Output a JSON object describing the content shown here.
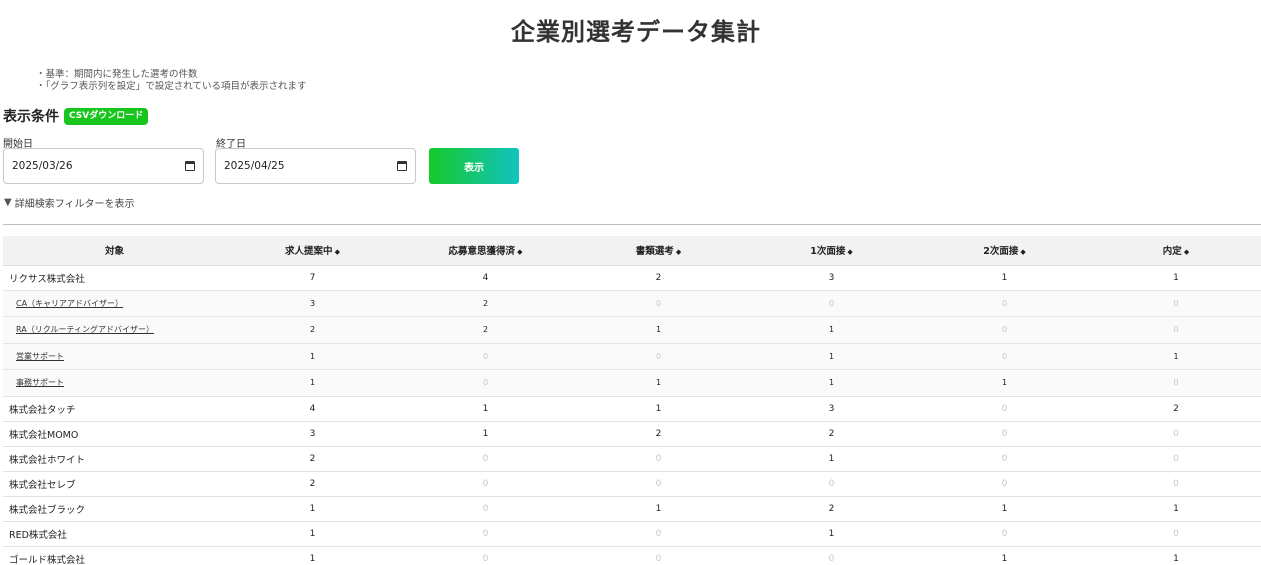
{
  "page": {
    "title": "企業別選考データ集計"
  },
  "notes": [
    "・基準：期間内に発生した選考の件数",
    "・「グラフ表示列を設定」で設定されている項目が表示されます"
  ],
  "conditions": {
    "title": "表示条件",
    "csv_label": "CSVダウンロード",
    "start_label": "開始日",
    "start_value": "2025/03/26",
    "end_label": "終了日",
    "end_value": "2025/04/25",
    "show_label": "表示",
    "filter_toggle": "詳細検索フィルターを表示"
  },
  "colors": {
    "csv_green": "#17c51c",
    "gradient_start": "#15c92a",
    "gradient_end": "#12c3bf"
  },
  "table": {
    "columns": [
      "対象",
      "求人提案中",
      "応募意思獲得済",
      "書類選考",
      "1次面接",
      "2次面接",
      "内定"
    ],
    "rows": [
      {
        "name": "リクサス株式会社",
        "sub": false,
        "values": [
          "7",
          "4",
          "2",
          "3",
          "1",
          "1"
        ]
      },
      {
        "name": "CA（キャリアアドバイザー）",
        "sub": true,
        "values": [
          "3",
          "2",
          "0",
          "0",
          "0",
          "0"
        ]
      },
      {
        "name": "RA（リクルーティングアドバイザー）",
        "sub": true,
        "values": [
          "2",
          "2",
          "1",
          "1",
          "0",
          "0"
        ]
      },
      {
        "name": "営業サポート",
        "sub": true,
        "values": [
          "1",
          "0",
          "0",
          "1",
          "0",
          "1"
        ]
      },
      {
        "name": "事務サポート",
        "sub": true,
        "values": [
          "1",
          "0",
          "1",
          "1",
          "1",
          "0"
        ]
      },
      {
        "name": "株式会社タッチ",
        "sub": false,
        "values": [
          "4",
          "1",
          "1",
          "3",
          "0",
          "2"
        ]
      },
      {
        "name": "株式会社MOMO",
        "sub": false,
        "values": [
          "3",
          "1",
          "2",
          "2",
          "0",
          "0"
        ]
      },
      {
        "name": "株式会社ホワイト",
        "sub": false,
        "values": [
          "2",
          "0",
          "0",
          "1",
          "0",
          "0"
        ]
      },
      {
        "name": "株式会社セレブ",
        "sub": false,
        "values": [
          "2",
          "0",
          "0",
          "0",
          "0",
          "0"
        ]
      },
      {
        "name": "株式会社ブラック",
        "sub": false,
        "values": [
          "1",
          "0",
          "1",
          "2",
          "1",
          "1"
        ]
      },
      {
        "name": "RED株式会社",
        "sub": false,
        "values": [
          "1",
          "0",
          "0",
          "1",
          "0",
          "0"
        ]
      },
      {
        "name": "ゴールド株式会社",
        "sub": false,
        "values": [
          "1",
          "0",
          "0",
          "0",
          "1",
          "1"
        ]
      }
    ]
  }
}
